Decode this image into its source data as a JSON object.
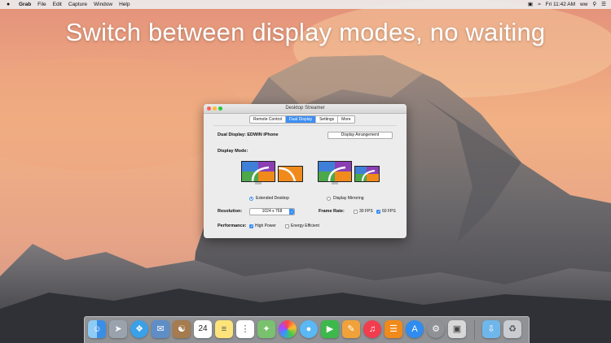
{
  "headline": "Switch between display modes, no waiting",
  "menubar": {
    "app_name": "Grab",
    "items": [
      "File",
      "Edit",
      "Capture",
      "Window",
      "Help"
    ],
    "clock": "Fri 11:42 AM",
    "user": "ww"
  },
  "window": {
    "title": "Desktop Streamer",
    "tabs": [
      {
        "label": "Remote Control",
        "active": false
      },
      {
        "label": "Dual Display",
        "active": true
      },
      {
        "label": "Settings",
        "active": false
      },
      {
        "label": "More",
        "active": false
      }
    ],
    "dual_display_label": "Dual Display: EDWIN iPhone",
    "arrangement_button": "Display Arrangement",
    "display_mode_label": "Display Mode:",
    "modes": [
      {
        "label": "Extended Desktop",
        "selected": true
      },
      {
        "label": "Display Mirroring",
        "selected": false
      }
    ],
    "resolution_label": "Resolution:",
    "resolution_value": "1024 x 768",
    "frame_rate_label": "Frame Rate:",
    "fps_options": [
      {
        "label": "30 FPS",
        "checked": false
      },
      {
        "label": "60 FPS",
        "checked": true
      }
    ],
    "performance_label": "Performance:",
    "performance_options": [
      {
        "label": "High Power",
        "checked": true
      },
      {
        "label": "Energy Efficient",
        "checked": false
      }
    ]
  },
  "dock_icons": [
    "finder-icon",
    "launchpad-icon",
    "safari-icon",
    "mail-icon",
    "contacts-icon",
    "calendar-icon",
    "notes-icon",
    "reminders-icon",
    "maps-icon",
    "photos-icon",
    "messages-icon",
    "facetime-icon",
    "pages-icon",
    "music-icon",
    "books-icon",
    "app-store-icon",
    "system-preferences-icon",
    "preview-icon",
    "downloads-folder-icon",
    "trash-icon"
  ],
  "calendar_day": "24",
  "colors": {
    "accent": "#3b8ef5"
  }
}
